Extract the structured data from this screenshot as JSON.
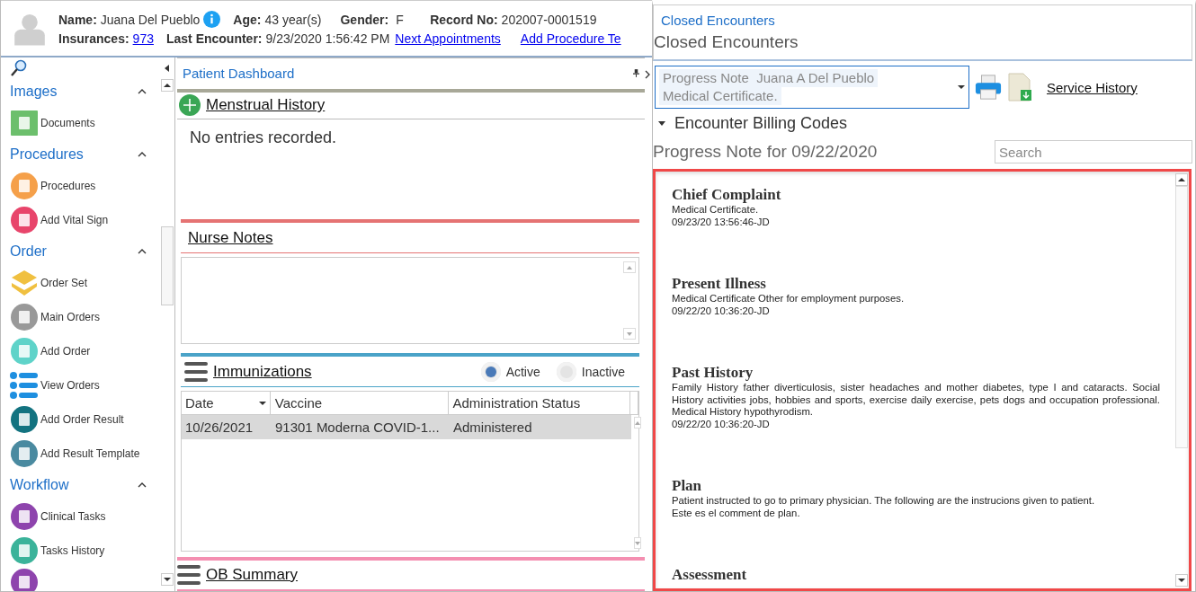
{
  "patient": {
    "name_label": "Name:",
    "name": "Juana Del Pueblo",
    "age_label": "Age:",
    "age": "43 year(s)",
    "gender_label": "Gender:",
    "gender": "F",
    "record_label": "Record No:",
    "record": "202007-0001519",
    "insurances_label": "Insurances:",
    "insurances": "973",
    "last_encounter_label": "Last Encounter:",
    "last_encounter": "9/23/2020 1:56:42 PM",
    "links": [
      "Next Appointments",
      "Add Procedure Te"
    ]
  },
  "sidebar": {
    "groups": [
      {
        "title": "Images",
        "expanded": true,
        "items": [
          "Documents"
        ]
      },
      {
        "title": "Procedures",
        "expanded": true,
        "items": [
          "Procedures",
          "Add Vital Sign"
        ]
      },
      {
        "title": "Order",
        "expanded": true,
        "items": [
          "Order Set",
          "Main Orders",
          "Add Order",
          "View Orders",
          "Add Order Result",
          "Add Result Template"
        ]
      },
      {
        "title": "Workflow",
        "expanded": true,
        "items": [
          "Clinical Tasks",
          "Tasks History"
        ]
      }
    ]
  },
  "dashboard": {
    "title": "Patient Dashboard",
    "menstrual": {
      "title": "Menstrual History",
      "empty": "No entries recorded."
    },
    "nurse_notes": {
      "title": "Nurse Notes"
    },
    "immunizations": {
      "title": "Immunizations",
      "filters": [
        {
          "label": "Active",
          "selected": true
        },
        {
          "label": "Inactive",
          "selected": false
        }
      ],
      "columns": [
        "Date",
        "Vaccine",
        "Administration Status"
      ],
      "rows": [
        {
          "cells": [
            "10/26/2021",
            "91301 Moderna COVID-1...",
            "Administered"
          ],
          "selected": true
        }
      ]
    },
    "ob_summary": {
      "title": "OB Summary"
    }
  },
  "encounters": {
    "panel_title": "Closed Encounters",
    "heading": "Closed Encounters",
    "dropdown": [
      "Progress Note  Juana A Del Pueblo",
      "Medical Certificate."
    ],
    "service_history": "Service History",
    "billing_codes": "Encounter Billing Codes",
    "note_title": "Progress Note for 09/22/2020",
    "search": {
      "placeholder": "Search"
    },
    "notes": [
      {
        "heading": "Chief Complaint",
        "lines": [
          "Medical Certificate.",
          "09/23/20 13:56:46-JD"
        ]
      },
      {
        "heading": "Present Illness",
        "lines": [
          "Medical Certificate Other for employment purposes.",
          "09/22/20 10:36:20-JD"
        ]
      },
      {
        "heading": "Past History",
        "lines": [
          "Family History father diverticulosis, sister headaches and mother diabetes, type I and cataracts. Social History activities jobs, hobbies and sports, exercise daily exercise, pets dogs and occupation professional. Medical History hypothyrodism.",
          "09/22/20 10:36:20-JD"
        ]
      },
      {
        "heading": "Plan",
        "lines": [
          "Patient instructed to go to primary physician. The following are the instrucions given to patient.",
          "Este es el comment de plan."
        ]
      },
      {
        "heading": "Assessment"
      }
    ]
  }
}
